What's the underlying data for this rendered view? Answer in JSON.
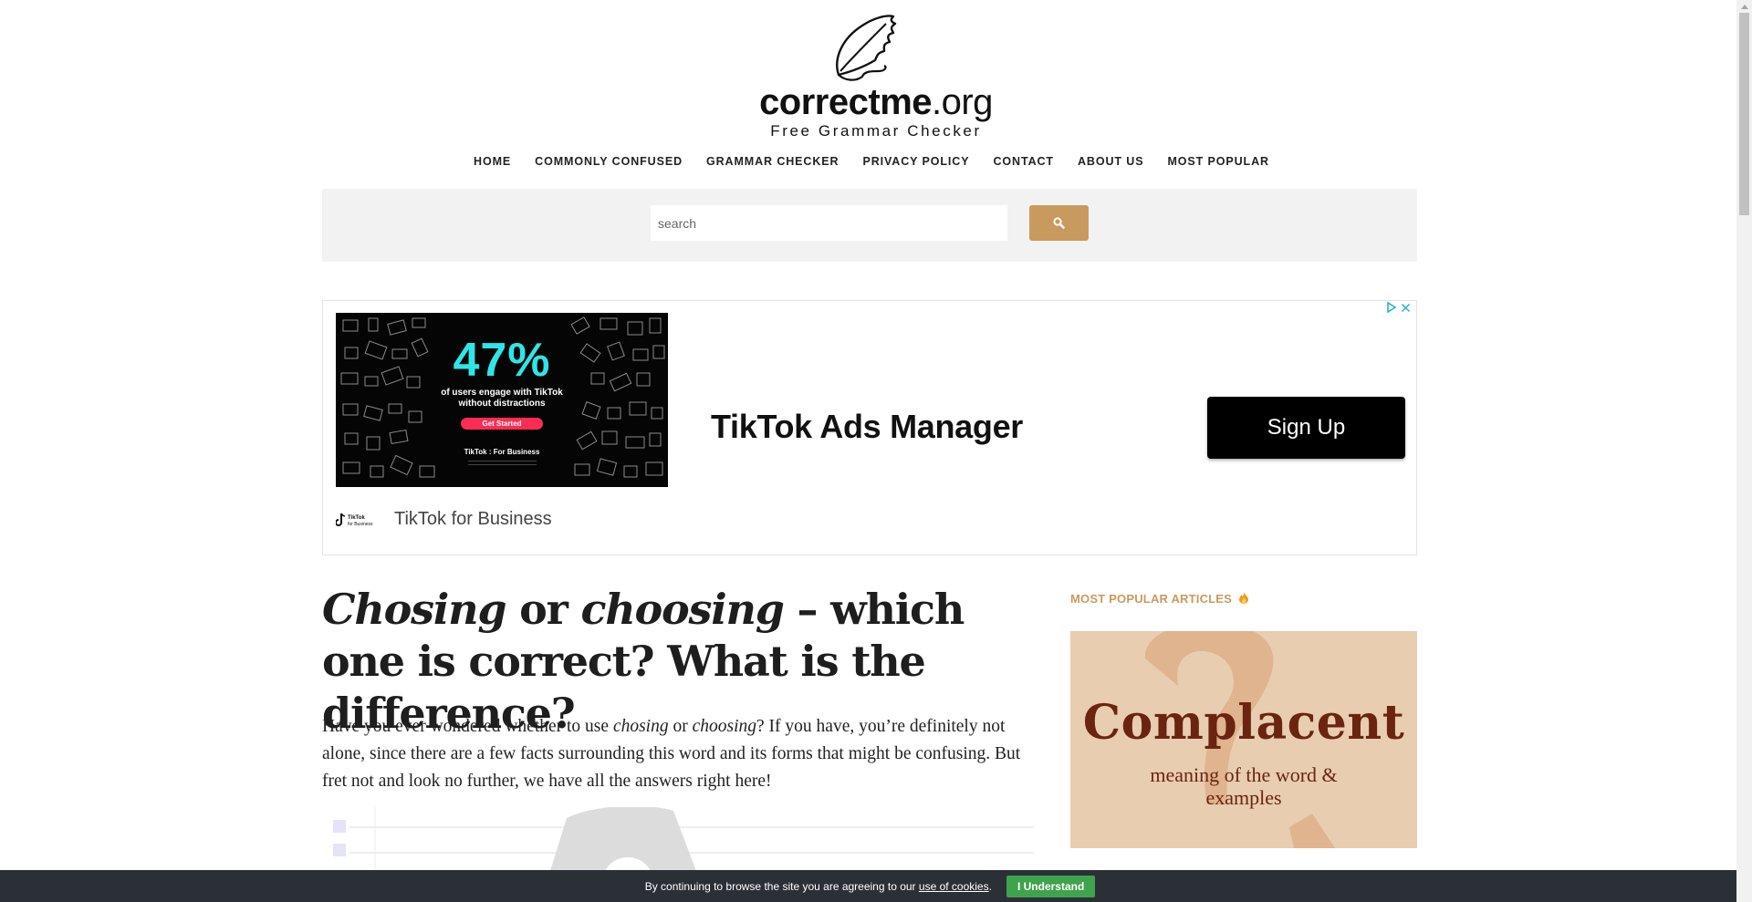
{
  "site": {
    "brand_bold": "correctme",
    "brand_light": ".org",
    "tagline": "Free Grammar Checker"
  },
  "nav": {
    "items": [
      {
        "label": "HOME"
      },
      {
        "label": "COMMONLY CONFUSED"
      },
      {
        "label": "GRAMMAR CHECKER"
      },
      {
        "label": "PRIVACY POLICY"
      },
      {
        "label": "CONTACT"
      },
      {
        "label": "ABOUT US"
      },
      {
        "label": "MOST POPULAR"
      }
    ]
  },
  "search": {
    "placeholder": "search",
    "value": "",
    "button_icon": "search-icon"
  },
  "ad": {
    "image": {
      "stat": "47%",
      "stat_line1": "of users engage with TikTok",
      "stat_line2": "without distractions",
      "cta": "Get Started",
      "brand": "TikTok : For Business"
    },
    "headline": "TikTok Ads Manager",
    "cta_label": "Sign Up",
    "advertiser": "TikTok for Business",
    "advertiser_logo_text": "TikTok for Business",
    "choices_icons": [
      "adchoices-icon",
      "close-icon"
    ]
  },
  "article": {
    "title_part1": "Chosing",
    "title_part2": " or ",
    "title_part3": "choosing",
    "title_part4": " – which one is correct? What is the difference?",
    "intro_part1": "Have you ever wondered whether to use ",
    "intro_em1": "chosing",
    "intro_part2": " or ",
    "intro_em2": "choosing",
    "intro_part3": "? If you have, you’re definitely not alone, since there are a few facts surrounding this word and its forms that might be confusing. But fret not and look no further, we have all the answers right here!"
  },
  "sidebar": {
    "heading": "MOST POPULAR ARTICLES",
    "heading_icon": "fire-icon",
    "card": {
      "word": "Complacent",
      "description": "meaning of the word & examples"
    }
  },
  "cookie": {
    "message": "By continuing to browse the site you are agreeing to our ",
    "link": "use of cookies",
    "suffix": ".",
    "button": "I Understand"
  },
  "colors": {
    "accent": "#c99a5e",
    "cookie_bar": "#2b2f36",
    "cookie_button": "#3fa34d",
    "card_bg": "#e8cdb0",
    "card_text": "#6b2410"
  }
}
